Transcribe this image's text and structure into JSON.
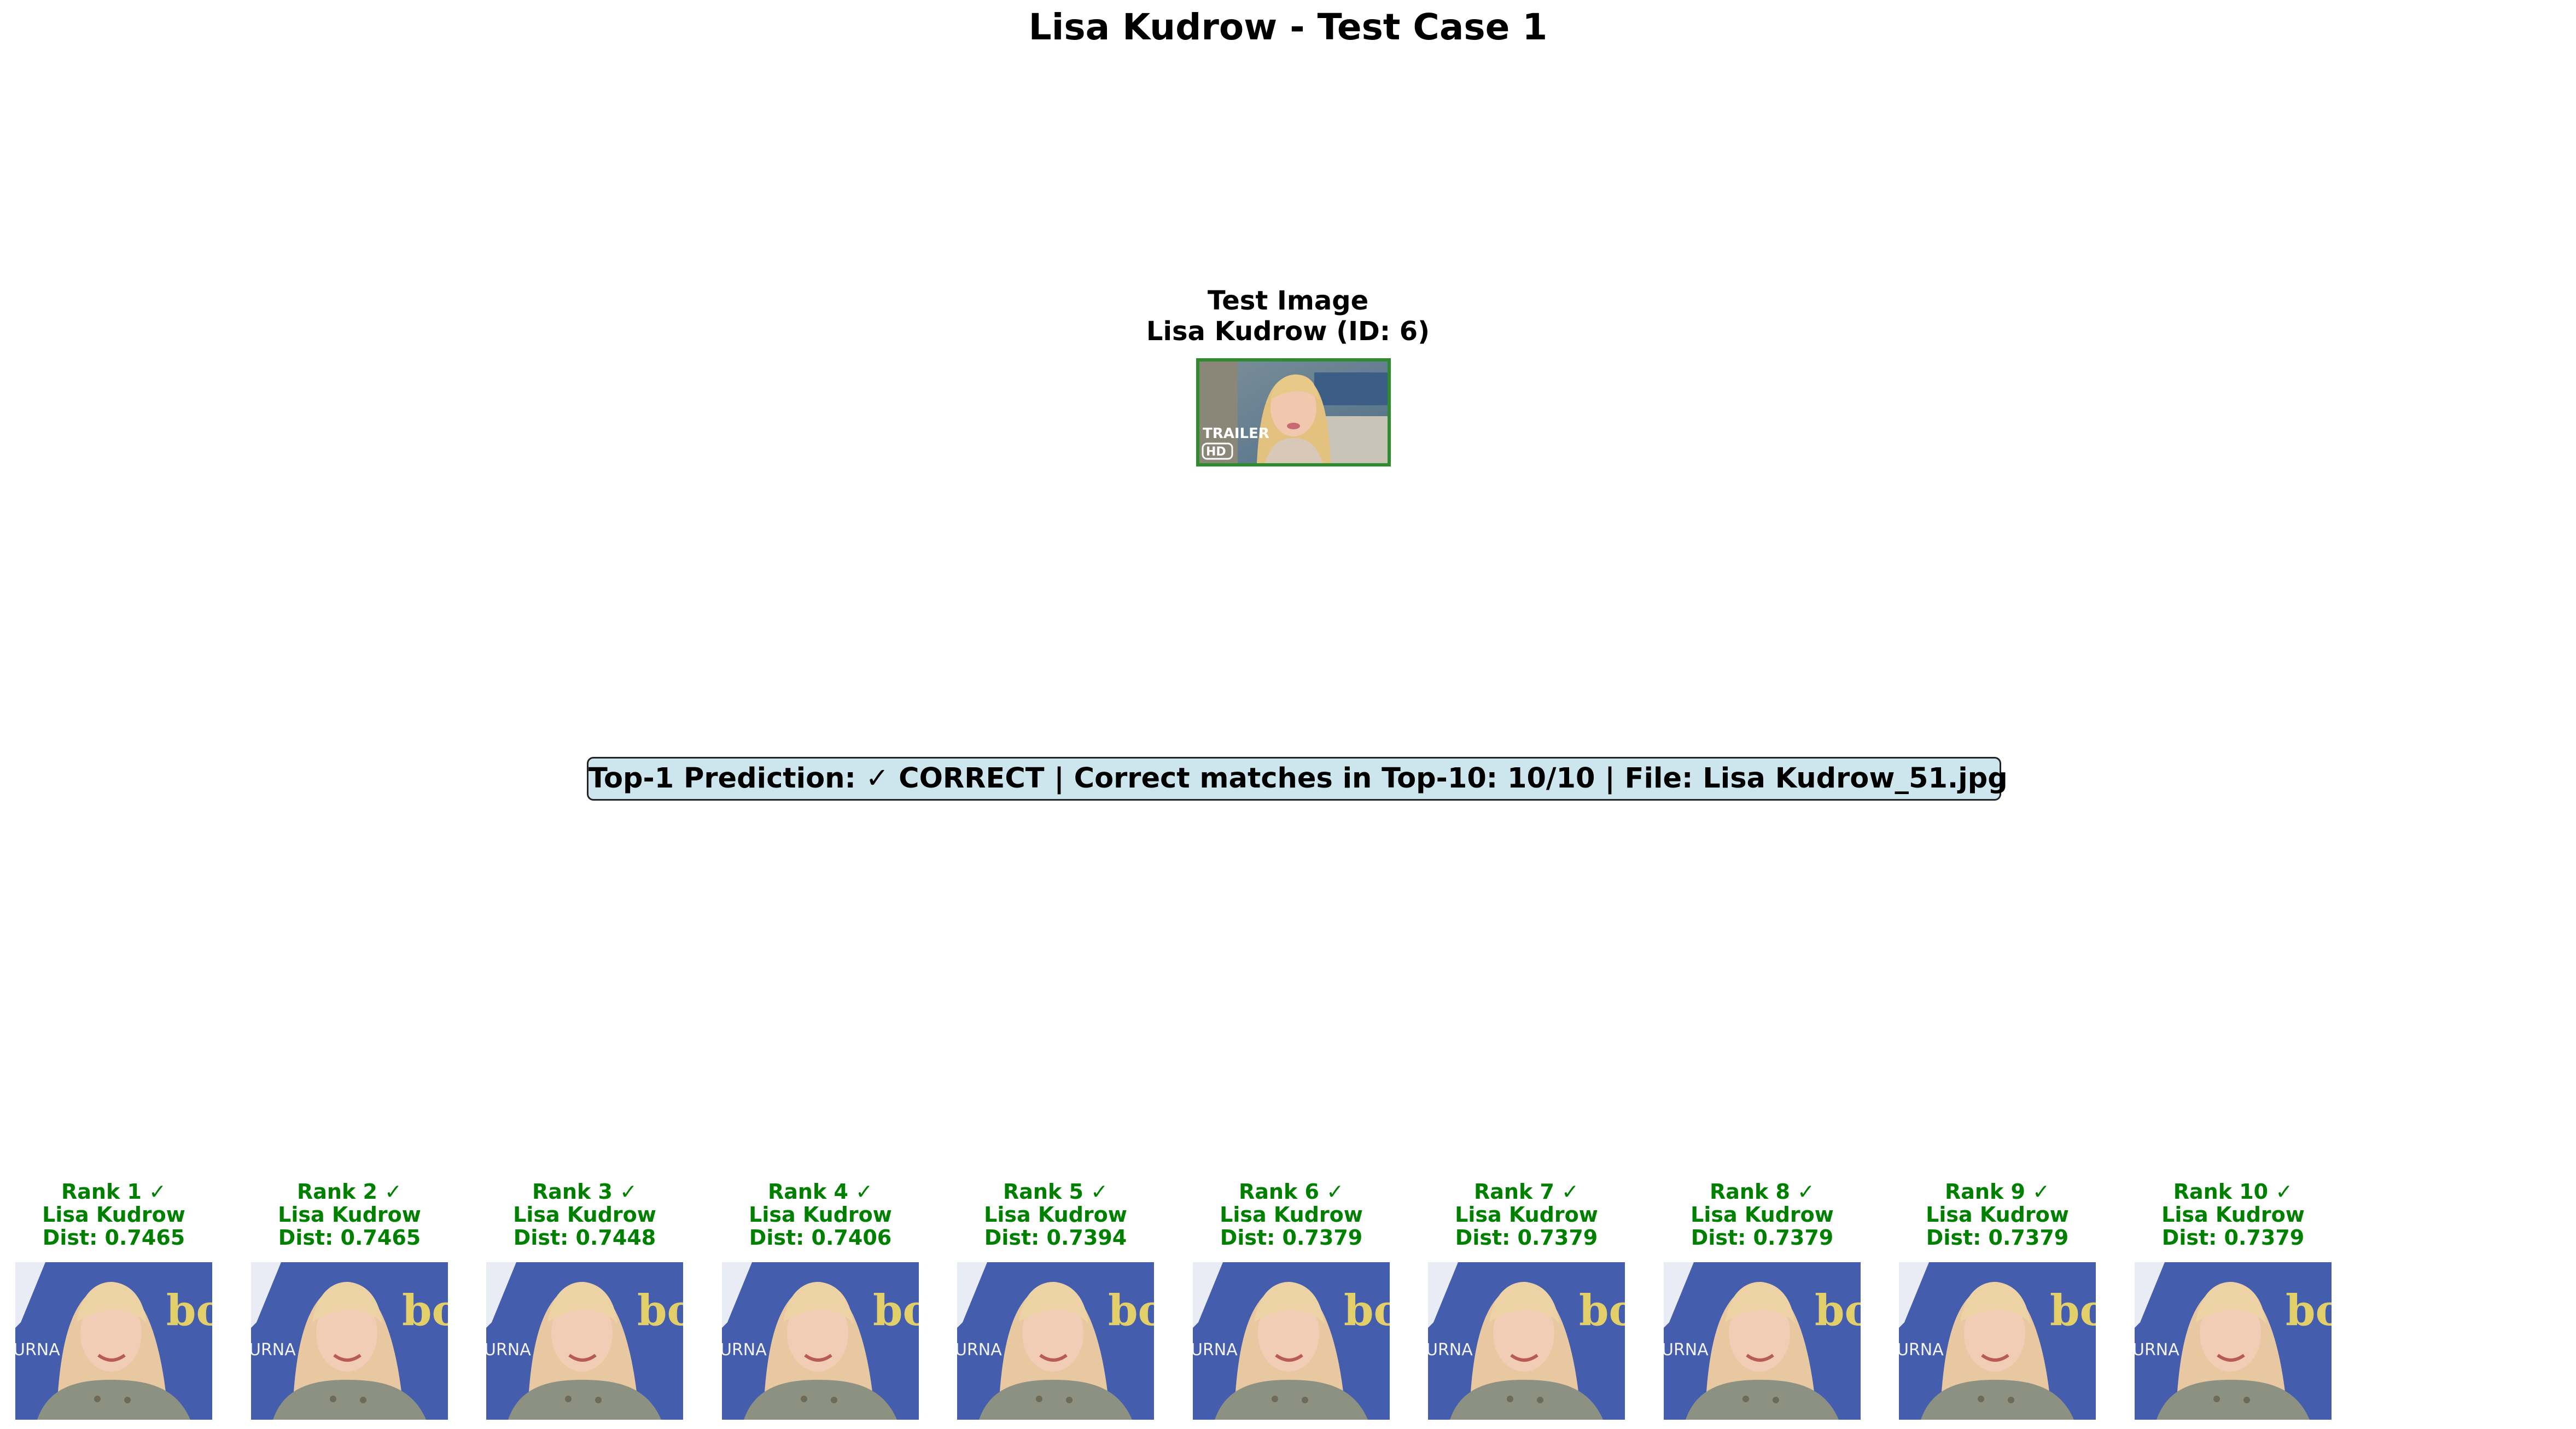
{
  "figure": {
    "title": "Lisa Kudrow - Test Case 1"
  },
  "test": {
    "heading": "Test Image",
    "identity": "Lisa Kudrow (ID: 6)",
    "image_overlay": {
      "label_trailer": "TRAILER",
      "label_hd": "HD"
    },
    "border_color": "#2e8b2e"
  },
  "summary": {
    "text": "Top-1 Prediction: ✓ CORRECT | Correct matches in Top-10: 10/10 | File: Lisa Kudrow_51.jpg",
    "background_color": "#cde6ee"
  },
  "results_style": {
    "caption_color": "#008000"
  },
  "results": [
    {
      "rank": "Rank 1 ✓",
      "name": "Lisa Kudrow",
      "dist": "Dist: 0.7465",
      "image_text": {
        "left": "URNA",
        "right": "bo"
      }
    },
    {
      "rank": "Rank 2 ✓",
      "name": "Lisa Kudrow",
      "dist": "Dist: 0.7465",
      "image_text": {
        "left": "URNA",
        "right": "bo"
      }
    },
    {
      "rank": "Rank 3 ✓",
      "name": "Lisa Kudrow",
      "dist": "Dist: 0.7448",
      "image_text": {
        "left": "URNA",
        "right": "bo"
      }
    },
    {
      "rank": "Rank 4 ✓",
      "name": "Lisa Kudrow",
      "dist": "Dist: 0.7406",
      "image_text": {
        "left": "URNA",
        "right": "bo"
      }
    },
    {
      "rank": "Rank 5 ✓",
      "name": "Lisa Kudrow",
      "dist": "Dist: 0.7394",
      "image_text": {
        "left": "URNA",
        "right": "bo"
      }
    },
    {
      "rank": "Rank 6 ✓",
      "name": "Lisa Kudrow",
      "dist": "Dist: 0.7379",
      "image_text": {
        "left": "URNA",
        "right": "bo"
      }
    },
    {
      "rank": "Rank 7 ✓",
      "name": "Lisa Kudrow",
      "dist": "Dist: 0.7379",
      "image_text": {
        "left": "URNA",
        "right": "bo"
      }
    },
    {
      "rank": "Rank 8 ✓",
      "name": "Lisa Kudrow",
      "dist": "Dist: 0.7379",
      "image_text": {
        "left": "URNA",
        "right": "bo"
      }
    },
    {
      "rank": "Rank 9 ✓",
      "name": "Lisa Kudrow",
      "dist": "Dist: 0.7379",
      "image_text": {
        "left": "URNA",
        "right": "bo"
      }
    },
    {
      "rank": "Rank 10 ✓",
      "name": "Lisa Kudrow",
      "dist": "Dist: 0.7379",
      "image_text": {
        "left": "URNA",
        "right": "bo"
      }
    }
  ]
}
